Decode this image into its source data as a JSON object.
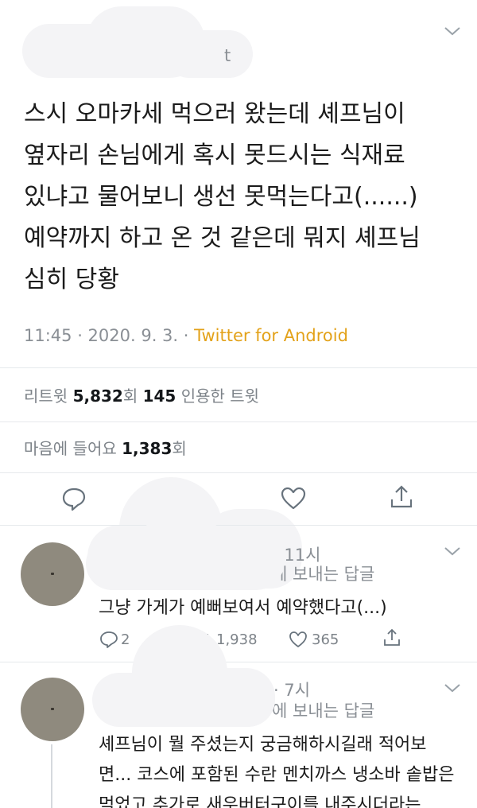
{
  "tweet": {
    "handle_fragment": "t",
    "lines": [
      "스시 오마카세 먹으러 왔는데 셰프님이",
      "옆자리 손님에게 혹시 못드시는 식재료",
      "있냐고 물어보니 생선 못먹는다고(......)",
      "예약까지 하고 온 것 같은데 뭐지 셰프님",
      "심히 당황"
    ],
    "time": "11:45 · 2020. 9. 3. · ",
    "source": "Twitter for Android",
    "retweet_label": "리트윗 ",
    "retweet_count": "5,832",
    "retweet_unit": "회  ",
    "quote_count": "145",
    "quote_label": " 인용한 트윗",
    "like_label": "마음에 들어요 ",
    "like_count": "1,383",
    "like_unit": "회"
  },
  "replies": [
    {
      "time": "· 11시",
      "reply_to": "에 보내는 답글",
      "text_lines": [
        "그냥 가게가 예뻐보여서 예약했다고(...)"
      ],
      "reply_count": "2",
      "retweet_count": "1,938",
      "like_count": "365"
    },
    {
      "time": "· 7시",
      "reply_to": "에 보내는 답글",
      "text_lines": [
        "셰프님이 뭘 주셨는지 궁금해하시길래 적어보",
        "면... 코스에 포함된 수란 멘치까스 냉소바 솥밥은",
        "먹었고 추가로 새우버터구이를 내주시더라는."
      ]
    }
  ],
  "colors": {
    "text": "#1b1b1b",
    "muted": "#8a8f95",
    "source": "#e3a21a",
    "icon": "#68737d",
    "divider": "#e6e9ec",
    "avatar": "#8f8a7e"
  },
  "icons": {
    "chevron": "chevron-down-icon",
    "reply": "reply-icon",
    "retweet": "retweet-icon",
    "like": "heart-icon",
    "share": "share-icon"
  }
}
